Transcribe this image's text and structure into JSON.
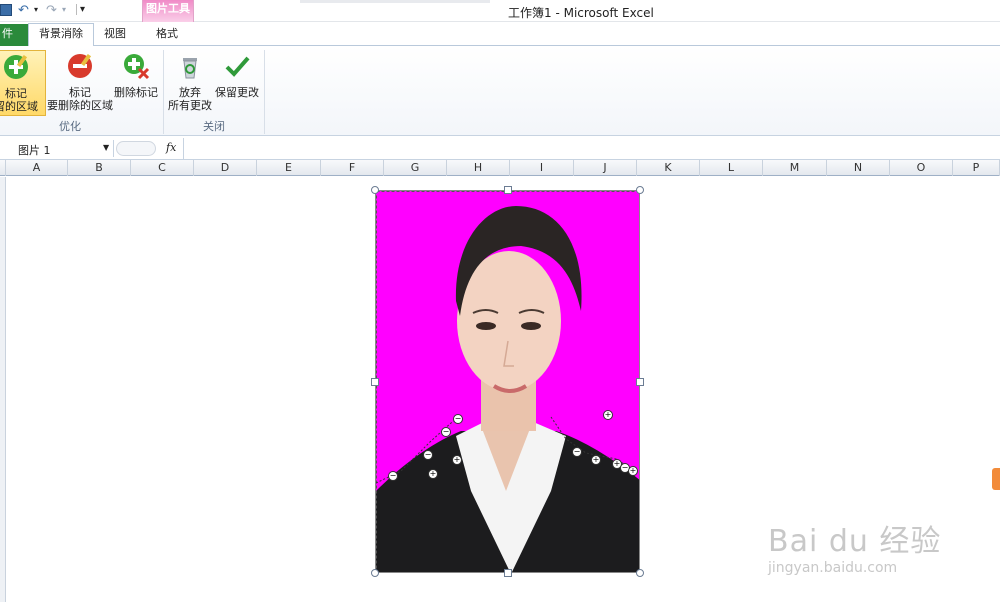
{
  "window": {
    "title": "工作簿1 - Microsoft Excel"
  },
  "qat": {
    "more": "▾"
  },
  "context_tab": {
    "group": "图片工具",
    "tab": "格式"
  },
  "tabs": [
    {
      "label": "件"
    },
    {
      "label": "背景消除"
    },
    {
      "label": "视图"
    }
  ],
  "ribbon": {
    "buttons": {
      "mark_keep": {
        "line1": "标记",
        "line2": "留的区域"
      },
      "mark_remove": {
        "line1": "标记",
        "line2": "要删除的区域"
      },
      "delete_mark": {
        "line1": "删除标记"
      },
      "discard": {
        "line1": "放弃",
        "line2": "所有更改"
      },
      "keep": {
        "line1": "保留更改"
      }
    },
    "groups": {
      "refine": "优化",
      "close": "关闭"
    }
  },
  "formula_bar": {
    "name_box": "图片 1",
    "fx": "fx",
    "value": ""
  },
  "columns": [
    "A",
    "B",
    "C",
    "D",
    "E",
    "F",
    "G",
    "H",
    "I",
    "J",
    "K",
    "L",
    "M",
    "N",
    "O",
    "P"
  ],
  "colors": {
    "accent_green": "#2a8a3b",
    "context_pink": "#f08bc7",
    "removal_magenta": "#ff00ff"
  },
  "watermark": {
    "brand": "Bai du 经验",
    "url": "jingyan.baidu.com"
  }
}
